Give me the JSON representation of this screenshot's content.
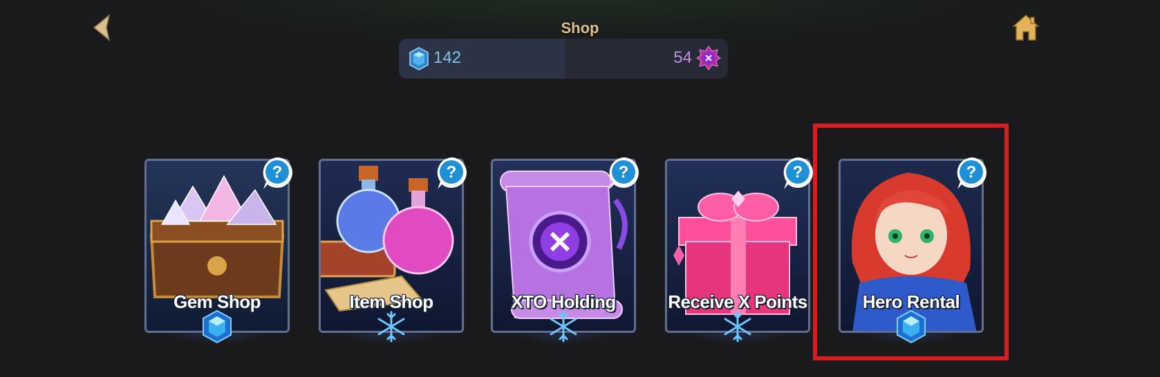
{
  "header": {
    "title": "Shop"
  },
  "currency": {
    "gems": "142",
    "points": "54"
  },
  "cards": [
    {
      "label": "Gem Shop",
      "emblem": "gem",
      "art": "treasure-chest"
    },
    {
      "label": "Item Shop",
      "emblem": "snowflake",
      "art": "potions"
    },
    {
      "label": "XTO Holding",
      "emblem": "snowflake",
      "art": "scroll"
    },
    {
      "label": "Receive X Points",
      "emblem": "snowflake",
      "art": "gift-box"
    },
    {
      "label": "Hero Rental",
      "emblem": "gem",
      "art": "hero-portrait"
    }
  ],
  "colors": {
    "title": "#dcc08a",
    "gem_text": "#7dc3ec",
    "points_text": "#c48ee6",
    "highlight": "#dd1b1b",
    "help_blue": "#1f8fd6"
  }
}
